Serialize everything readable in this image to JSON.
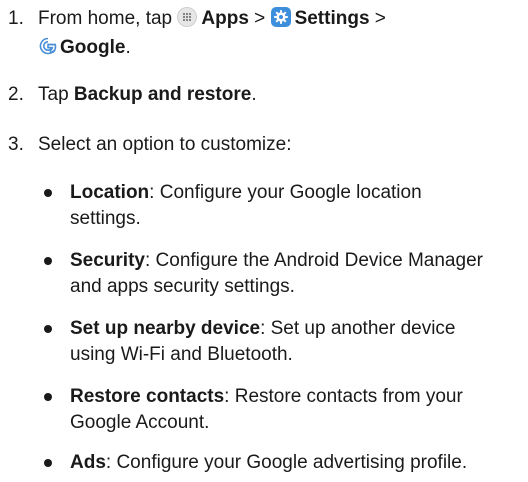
{
  "steps": [
    {
      "number": "1.",
      "text_from_home": "From home, tap",
      "apps_label": "Apps",
      "sep1": ">",
      "settings_label": "Settings",
      "sep2": ">",
      "google_label": "Google",
      "period": "."
    },
    {
      "number": "2.",
      "text_tap": "Tap",
      "backup_label": "Backup and restore",
      "period": "."
    },
    {
      "number": "3.",
      "text": "Select an option to customize:"
    }
  ],
  "options": [
    {
      "label": "Location",
      "desc_line1": ": Configure your Google location",
      "desc_line2": "settings."
    },
    {
      "label": "Security",
      "desc_line1": ": Configure the Android Device Manager",
      "desc_line2": "and apps security settings."
    },
    {
      "label": "Set up nearby device",
      "desc_line1": ": Set up another device",
      "desc_line2": "using Wi-Fi and Bluetooth."
    },
    {
      "label": "Restore contacts",
      "desc_line1": ": Restore contacts from your",
      "desc_line2": "Google Account."
    },
    {
      "label": "Ads",
      "desc_line1": ": Configure your Google advertising profile.",
      "desc_line2": ""
    }
  ],
  "icons": {
    "apps": "apps-grid-icon",
    "settings": "settings-gear-icon",
    "google": "google-g-icon"
  },
  "colors": {
    "text": "#1a1a1a",
    "settings_icon_bg": "#3d8fdc",
    "google_icon": "#4a8fd8",
    "apps_icon_bg": "#e6e6e6"
  }
}
